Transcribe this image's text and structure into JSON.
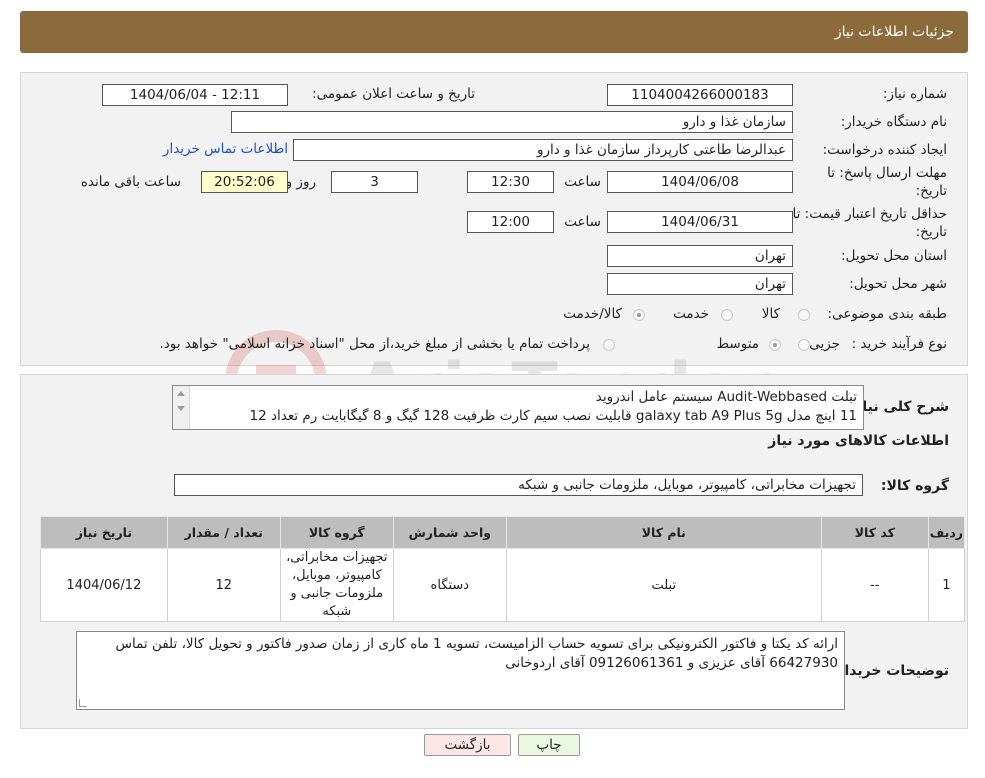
{
  "header": {
    "title": "جزئیات اطلاعات نیاز"
  },
  "form": {
    "need_number_label": "شماره نیاز:",
    "need_number": "1104004266000183",
    "announce_label": "تاریخ و ساعت اعلان عمومی:",
    "announce_value": "1404/06/04 - 12:11",
    "buyer_org_label": "نام دستگاه خریدار:",
    "buyer_org": "سازمان غذا و دارو",
    "creator_label": "ایجاد کننده درخواست:",
    "creator": "عبدالرضا طاعتی کارپرداز سازمان غذا و دارو",
    "contact_link": "اطلاعات تماس خریدار",
    "deadline_label_1": "مهلت ارسال پاسخ: تا",
    "deadline_label_2": "تاریخ:",
    "deadline_date": "1404/06/08",
    "hour_label": "ساعت",
    "deadline_time": "12:30",
    "days_value": "3",
    "days_label": "روز و",
    "remaining_time": "20:52:06",
    "remaining_label": "ساعت باقی مانده",
    "validity_label_1": "حداقل تاریخ اعتبار قیمت: تا",
    "validity_label_2": "تاریخ:",
    "validity_date": "1404/06/31",
    "validity_hour_label": "ساعت",
    "validity_time": "12:00",
    "province_label": "استان محل تحویل:",
    "province": "تهران",
    "city_label": "شهر محل تحویل:",
    "city": "تهران",
    "category_label": "طبقه بندی موضوعی:",
    "category_options": [
      "کالا",
      "خدمت",
      "کالا/خدمت"
    ],
    "purchase_type_label": "نوع فرآیند خرید :",
    "purchase_options": [
      "جزیی",
      "متوسط"
    ],
    "purchase_note": "پرداخت تمام یا بخشی از مبلغ خرید،از محل \"اسناد خزانه اسلامی\" خواهد بود."
  },
  "description": {
    "label": "شرح کلی نیاز:",
    "line1": "تبلت Audit-Webbased سیستم عامل اندروید",
    "line2": "11 اینچ مدل galaxy tab A9 Plus 5g قابلیت نصب سیم کارت ظرفیت 128 گیگ و 8 گیگابایت رم تعداد 12"
  },
  "goods": {
    "section_title": "اطلاعات کالاهای مورد نیاز",
    "group_label": "گروه کالا:",
    "group_value": "تجهیزات مخابراتی، کامپیوتر، موبایل، ملزومات جانبی و شبکه",
    "columns": [
      "ردیف",
      "کد کالا",
      "نام کالا",
      "واحد شمارش",
      "گروه کالا",
      "تعداد / مقدار",
      "تاریخ نیاز"
    ],
    "rows": [
      {
        "row": "1",
        "code": "--",
        "name": "تبلت",
        "unit": "دستگاه",
        "group": "تجهیزات مخابراتی، کامپیوتر، موبایل، ملزومات جانبی و شبکه",
        "qty": "12",
        "date": "1404/06/12"
      }
    ]
  },
  "buyer_notes": {
    "label": "توضیحات خریدار:",
    "text": "ارائه کد یکتا و فاکتور الکترونیکی برای تسویه حساب الزامیست، تسویه 1 ماه کاری از زمان صدور فاکتور و تحویل کالا، تلفن تماس 66427930 آقای عزیزی و 09126061361 آقای اردوخانی"
  },
  "buttons": {
    "print": "چاپ",
    "back": "بازگشت"
  },
  "watermark": {
    "text": "AriaTender.neT"
  },
  "colors": {
    "header": "#8b6a3c",
    "link": "#1a50c8",
    "highlight": "#ffffcc",
    "back_button": "#fde6e6",
    "print_button": "#eaf8e2"
  }
}
